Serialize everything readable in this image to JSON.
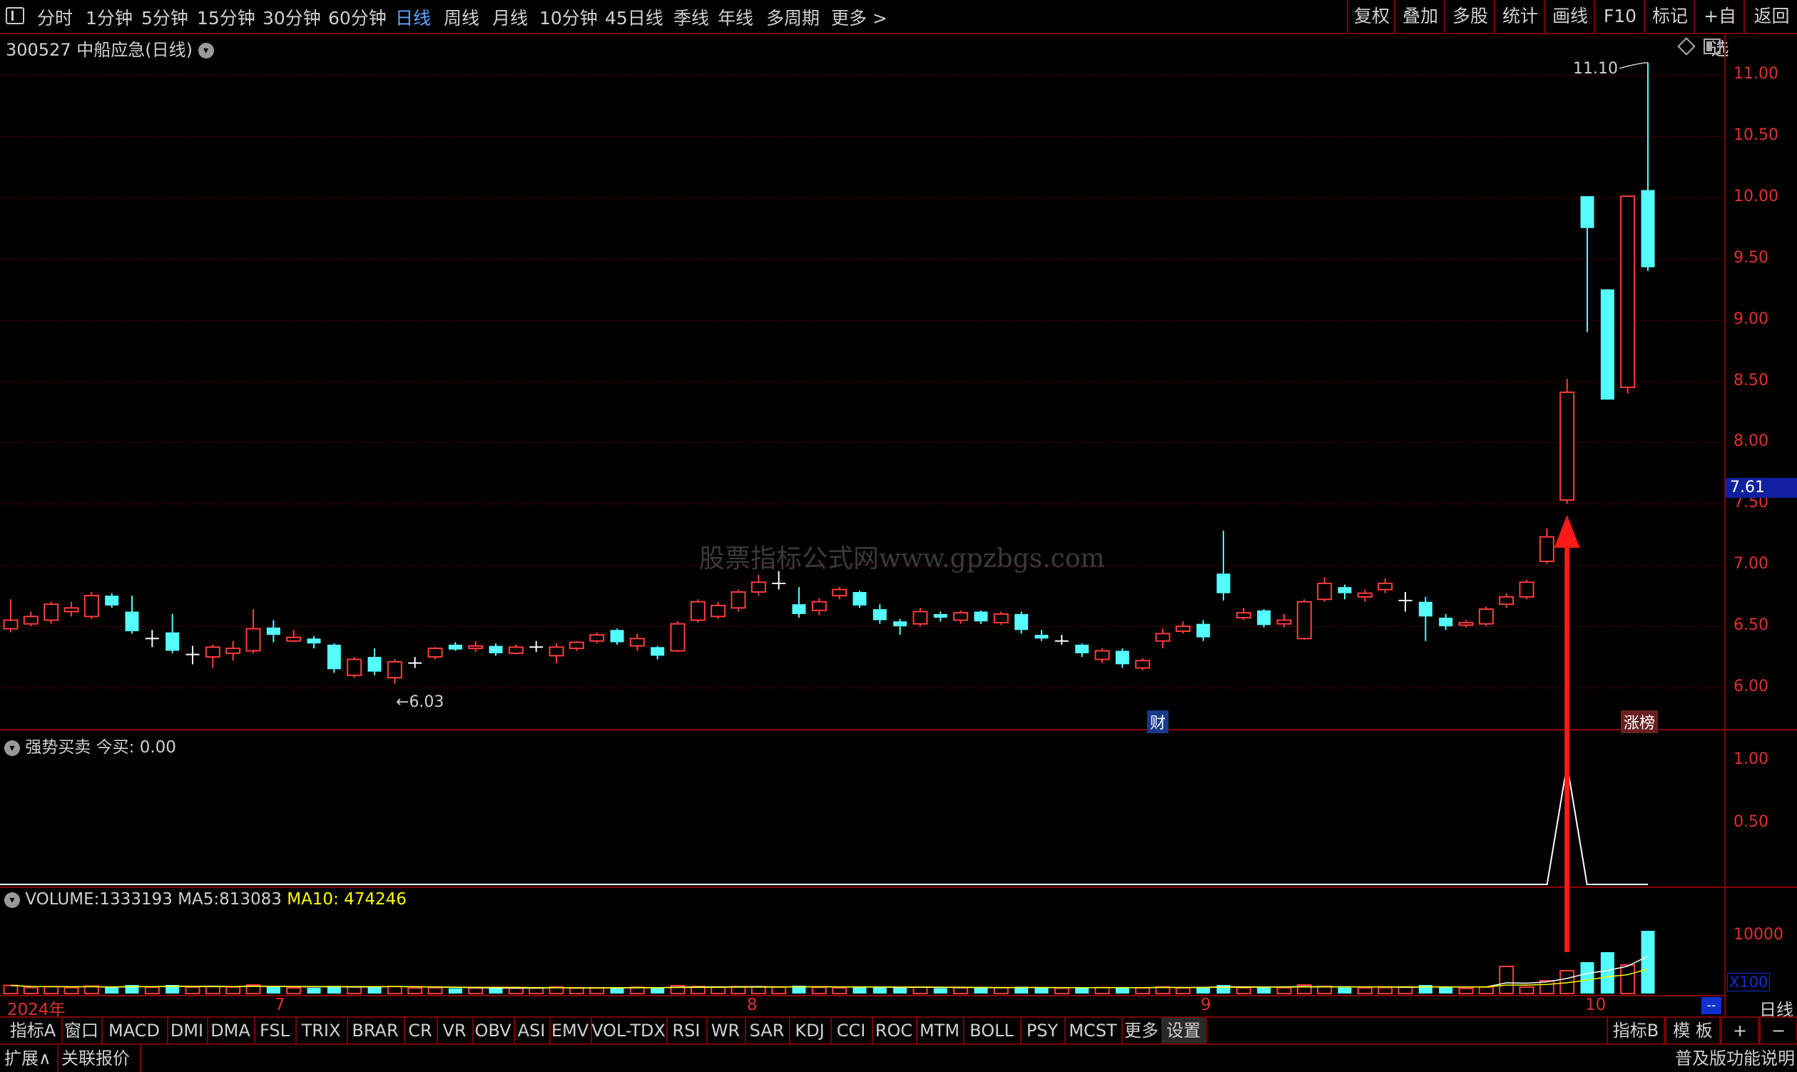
{
  "top_tabs": [
    "分时",
    "1分钟",
    "5分钟",
    "15分钟",
    "30分钟",
    "60分钟",
    "日线",
    "周线",
    "月线",
    "10分钟",
    "45日线",
    "季线",
    "年线",
    "多周期",
    "更多 >"
  ],
  "active_tab": "日线",
  "top_right_buttons": [
    "复权",
    "叠加",
    "多股",
    "统计",
    "画线",
    "F10",
    "标记",
    "+自选",
    "返回"
  ],
  "stock": {
    "code": "300527",
    "name": "中船应急",
    "period": "(日线)"
  },
  "price_axis": [
    "11.00",
    "10.50",
    "10.00",
    "9.50",
    "9.00",
    "8.50",
    "8.00",
    "7.50",
    "7.00",
    "6.50",
    "6.00"
  ],
  "current_price": "7.61",
  "high_label": "11.10",
  "low_label": "6.03",
  "watermark": "股票指标公式网www.gpzbgs.com",
  "markers": {
    "cai": "财",
    "zhangbang": "涨榜"
  },
  "indicator": {
    "name": "强势买卖",
    "today_label": "今买:",
    "today_value": "0.00",
    "axis": [
      "1.00",
      "0.50"
    ]
  },
  "volume": {
    "label": "VOLUME:",
    "value": "1333193",
    "ma5_label": "MA5:",
    "ma5": "813083",
    "ma10_label": "MA10:",
    "ma10": "474246",
    "axis_top": "10000",
    "multiplier": "X100"
  },
  "date_labels": [
    "2024年",
    "7",
    "8",
    "9",
    "10"
  ],
  "bottom_period": "日线",
  "indicator_tabs": [
    "指标A",
    "窗口",
    "MACD",
    "DMI",
    "DMA",
    "FSL",
    "TRIX",
    "BRAR",
    "CR",
    "VR",
    "OBV",
    "ASI",
    "EMV",
    "VOL-TDX",
    "RSI",
    "WR",
    "SAR",
    "KDJ",
    "CCI",
    "ROC",
    "MTM",
    "BOLL",
    "PSY",
    "MCST",
    "更多",
    "设置"
  ],
  "indicator_right": [
    "指标B",
    "模 板",
    "+",
    "−"
  ],
  "status_left": [
    "扩展∧",
    "关联报价"
  ],
  "status_right": "普及版功能说明",
  "colors": {
    "up": "#ff3c3c",
    "down": "#54fcfc",
    "axis": "#8a0000",
    "active_tab": "#5fa8ff",
    "ma10": "#ffff00"
  },
  "chart_data": {
    "type": "candlestick",
    "price_range": [
      5.8,
      11.2
    ],
    "candles": [
      {
        "o": 6.48,
        "c": 6.55,
        "h": 6.72,
        "l": 6.45
      },
      {
        "o": 6.52,
        "c": 6.58,
        "h": 6.62,
        "l": 6.5
      },
      {
        "o": 6.55,
        "c": 6.68,
        "h": 6.7,
        "l": 6.52
      },
      {
        "o": 6.62,
        "c": 6.65,
        "h": 6.7,
        "l": 6.58
      },
      {
        "o": 6.58,
        "c": 6.75,
        "h": 6.78,
        "l": 6.56
      },
      {
        "o": 6.75,
        "c": 6.67,
        "h": 6.77,
        "l": 6.65
      },
      {
        "o": 6.62,
        "c": 6.46,
        "h": 6.75,
        "l": 6.44
      },
      {
        "o": 6.4,
        "c": 6.4,
        "h": 6.47,
        "l": 6.33
      },
      {
        "o": 6.45,
        "c": 6.3,
        "h": 6.6,
        "l": 6.28
      },
      {
        "o": 6.27,
        "c": 6.27,
        "h": 6.34,
        "l": 6.19
      },
      {
        "o": 6.25,
        "c": 6.33,
        "h": 6.35,
        "l": 6.16
      },
      {
        "o": 6.28,
        "c": 6.32,
        "h": 6.38,
        "l": 6.22
      },
      {
        "o": 6.3,
        "c": 6.48,
        "h": 6.64,
        "l": 6.28
      },
      {
        "o": 6.49,
        "c": 6.43,
        "h": 6.55,
        "l": 6.37
      },
      {
        "o": 6.38,
        "c": 6.41,
        "h": 6.47,
        "l": 6.37
      },
      {
        "o": 6.4,
        "c": 6.36,
        "h": 6.42,
        "l": 6.32
      },
      {
        "o": 6.35,
        "c": 6.15,
        "h": 6.36,
        "l": 6.12
      },
      {
        "o": 6.1,
        "c": 6.23,
        "h": 6.25,
        "l": 6.08
      },
      {
        "o": 6.25,
        "c": 6.13,
        "h": 6.32,
        "l": 6.1
      },
      {
        "o": 6.08,
        "c": 6.21,
        "h": 6.23,
        "l": 6.03
      },
      {
        "o": 6.2,
        "c": 6.2,
        "h": 6.25,
        "l": 6.16
      },
      {
        "o": 6.25,
        "c": 6.32,
        "h": 6.33,
        "l": 6.23
      },
      {
        "o": 6.35,
        "c": 6.31,
        "h": 6.37,
        "l": 6.3
      },
      {
        "o": 6.32,
        "c": 6.34,
        "h": 6.38,
        "l": 6.29
      },
      {
        "o": 6.34,
        "c": 6.28,
        "h": 6.36,
        "l": 6.26
      },
      {
        "o": 6.28,
        "c": 6.33,
        "h": 6.35,
        "l": 6.27
      },
      {
        "o": 6.33,
        "c": 6.33,
        "h": 6.38,
        "l": 6.29
      },
      {
        "o": 6.26,
        "c": 6.33,
        "h": 6.36,
        "l": 6.2
      },
      {
        "o": 6.32,
        "c": 6.37,
        "h": 6.38,
        "l": 6.3
      },
      {
        "o": 6.38,
        "c": 6.43,
        "h": 6.45,
        "l": 6.36
      },
      {
        "o": 6.47,
        "c": 6.37,
        "h": 6.48,
        "l": 6.35
      },
      {
        "o": 6.34,
        "c": 6.4,
        "h": 6.44,
        "l": 6.3
      },
      {
        "o": 6.33,
        "c": 6.26,
        "h": 6.34,
        "l": 6.23
      },
      {
        "o": 6.3,
        "c": 6.52,
        "h": 6.54,
        "l": 6.29
      },
      {
        "o": 6.55,
        "c": 6.7,
        "h": 6.72,
        "l": 6.53
      },
      {
        "o": 6.58,
        "c": 6.67,
        "h": 6.7,
        "l": 6.56
      },
      {
        "o": 6.65,
        "c": 6.78,
        "h": 6.8,
        "l": 6.62
      },
      {
        "o": 6.78,
        "c": 6.86,
        "h": 6.92,
        "l": 6.75
      },
      {
        "o": 6.85,
        "c": 6.85,
        "h": 6.95,
        "l": 6.8
      },
      {
        "o": 6.68,
        "c": 6.6,
        "h": 6.82,
        "l": 6.57
      },
      {
        "o": 6.63,
        "c": 6.7,
        "h": 6.73,
        "l": 6.59
      },
      {
        "o": 6.75,
        "c": 6.8,
        "h": 6.82,
        "l": 6.72
      },
      {
        "o": 6.78,
        "c": 6.67,
        "h": 6.79,
        "l": 6.65
      },
      {
        "o": 6.64,
        "c": 6.55,
        "h": 6.68,
        "l": 6.52
      },
      {
        "o": 6.54,
        "c": 6.5,
        "h": 6.56,
        "l": 6.43
      },
      {
        "o": 6.52,
        "c": 6.62,
        "h": 6.65,
        "l": 6.5
      },
      {
        "o": 6.6,
        "c": 6.57,
        "h": 6.62,
        "l": 6.54
      },
      {
        "o": 6.55,
        "c": 6.61,
        "h": 6.63,
        "l": 6.52
      },
      {
        "o": 6.62,
        "c": 6.54,
        "h": 6.63,
        "l": 6.52
      },
      {
        "o": 6.53,
        "c": 6.6,
        "h": 6.62,
        "l": 6.51
      },
      {
        "o": 6.6,
        "c": 6.47,
        "h": 6.62,
        "l": 6.44
      },
      {
        "o": 6.43,
        "c": 6.4,
        "h": 6.47,
        "l": 6.38
      },
      {
        "o": 6.38,
        "c": 6.38,
        "h": 6.43,
        "l": 6.35
      },
      {
        "o": 6.35,
        "c": 6.28,
        "h": 6.36,
        "l": 6.25
      },
      {
        "o": 6.23,
        "c": 6.3,
        "h": 6.32,
        "l": 6.2
      },
      {
        "o": 6.3,
        "c": 6.19,
        "h": 6.32,
        "l": 6.16
      },
      {
        "o": 6.16,
        "c": 6.22,
        "h": 6.24,
        "l": 6.14
      },
      {
        "o": 6.38,
        "c": 6.44,
        "h": 6.48,
        "l": 6.32
      },
      {
        "o": 6.46,
        "c": 6.5,
        "h": 6.54,
        "l": 6.44
      },
      {
        "o": 6.52,
        "c": 6.41,
        "h": 6.55,
        "l": 6.38
      },
      {
        "o": 6.93,
        "c": 6.77,
        "h": 7.28,
        "l": 6.71
      },
      {
        "o": 6.57,
        "c": 6.61,
        "h": 6.65,
        "l": 6.55
      },
      {
        "o": 6.63,
        "c": 6.51,
        "h": 6.64,
        "l": 6.49
      },
      {
        "o": 6.52,
        "c": 6.55,
        "h": 6.6,
        "l": 6.49
      },
      {
        "o": 6.4,
        "c": 6.7,
        "h": 6.72,
        "l": 6.39
      },
      {
        "o": 6.72,
        "c": 6.85,
        "h": 6.9,
        "l": 6.7
      },
      {
        "o": 6.82,
        "c": 6.77,
        "h": 6.84,
        "l": 6.72
      },
      {
        "o": 6.74,
        "c": 6.77,
        "h": 6.8,
        "l": 6.7
      },
      {
        "o": 6.8,
        "c": 6.85,
        "h": 6.89,
        "l": 6.77
      },
      {
        "o": 6.71,
        "c": 6.71,
        "h": 6.78,
        "l": 6.62
      },
      {
        "o": 6.7,
        "c": 6.58,
        "h": 6.74,
        "l": 6.38
      },
      {
        "o": 6.57,
        "c": 6.5,
        "h": 6.6,
        "l": 6.47
      },
      {
        "o": 6.51,
        "c": 6.53,
        "h": 6.55,
        "l": 6.49
      },
      {
        "o": 6.52,
        "c": 6.64,
        "h": 6.66,
        "l": 6.5
      },
      {
        "o": 6.68,
        "c": 6.74,
        "h": 6.77,
        "l": 6.65
      },
      {
        "o": 6.74,
        "c": 6.86,
        "h": 6.88,
        "l": 6.72
      },
      {
        "o": 7.03,
        "c": 7.23,
        "h": 7.3,
        "l": 7.01
      },
      {
        "o": 7.53,
        "c": 8.41,
        "h": 8.52,
        "l": 7.5
      },
      {
        "o": 10.01,
        "c": 9.75,
        "h": 10.01,
        "l": 8.9
      },
      {
        "o": 9.25,
        "c": 8.35,
        "h": 9.25,
        "l": 8.35
      },
      {
        "o": 8.45,
        "c": 10.01,
        "h": 10.01,
        "l": 8.4
      },
      {
        "o": 10.06,
        "c": 9.43,
        "h": 11.1,
        "l": 9.4
      }
    ]
  }
}
